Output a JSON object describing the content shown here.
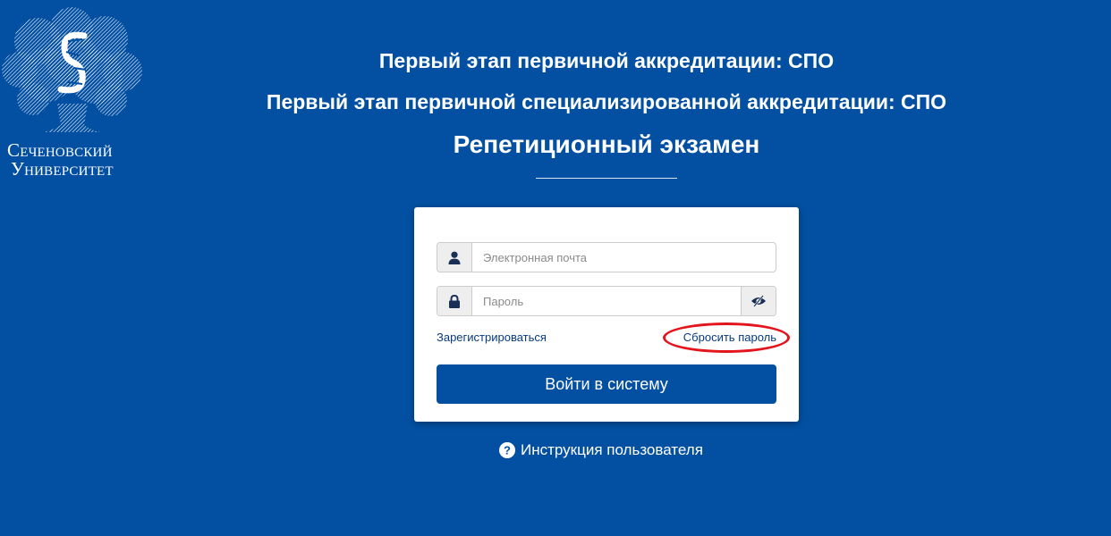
{
  "logo": {
    "line1": "Сеченовский",
    "line2": "Университет"
  },
  "header": {
    "title1": "Первый этап первичной аккредитации: СПО",
    "title2": "Первый этап первичной специализированной аккредитации: СПО",
    "title3": "Репетиционный экзамен"
  },
  "form": {
    "email": {
      "placeholder": "Электронная почта",
      "value": "",
      "icon": "user-icon"
    },
    "password": {
      "placeholder": "Пароль",
      "value": "",
      "icon": "lock-icon",
      "toggle_icon": "eye-slash-icon"
    },
    "register_label": "Зарегистрироваться",
    "reset_label": "Сбросить пароль",
    "submit_label": "Войти в систему"
  },
  "footer": {
    "help_label": "Инструкция пользователя",
    "help_icon": "question-circle-icon"
  },
  "colors": {
    "background": "#0350a2",
    "button": "#0350a2",
    "link": "#063a80",
    "annotation": "#e3141b"
  }
}
